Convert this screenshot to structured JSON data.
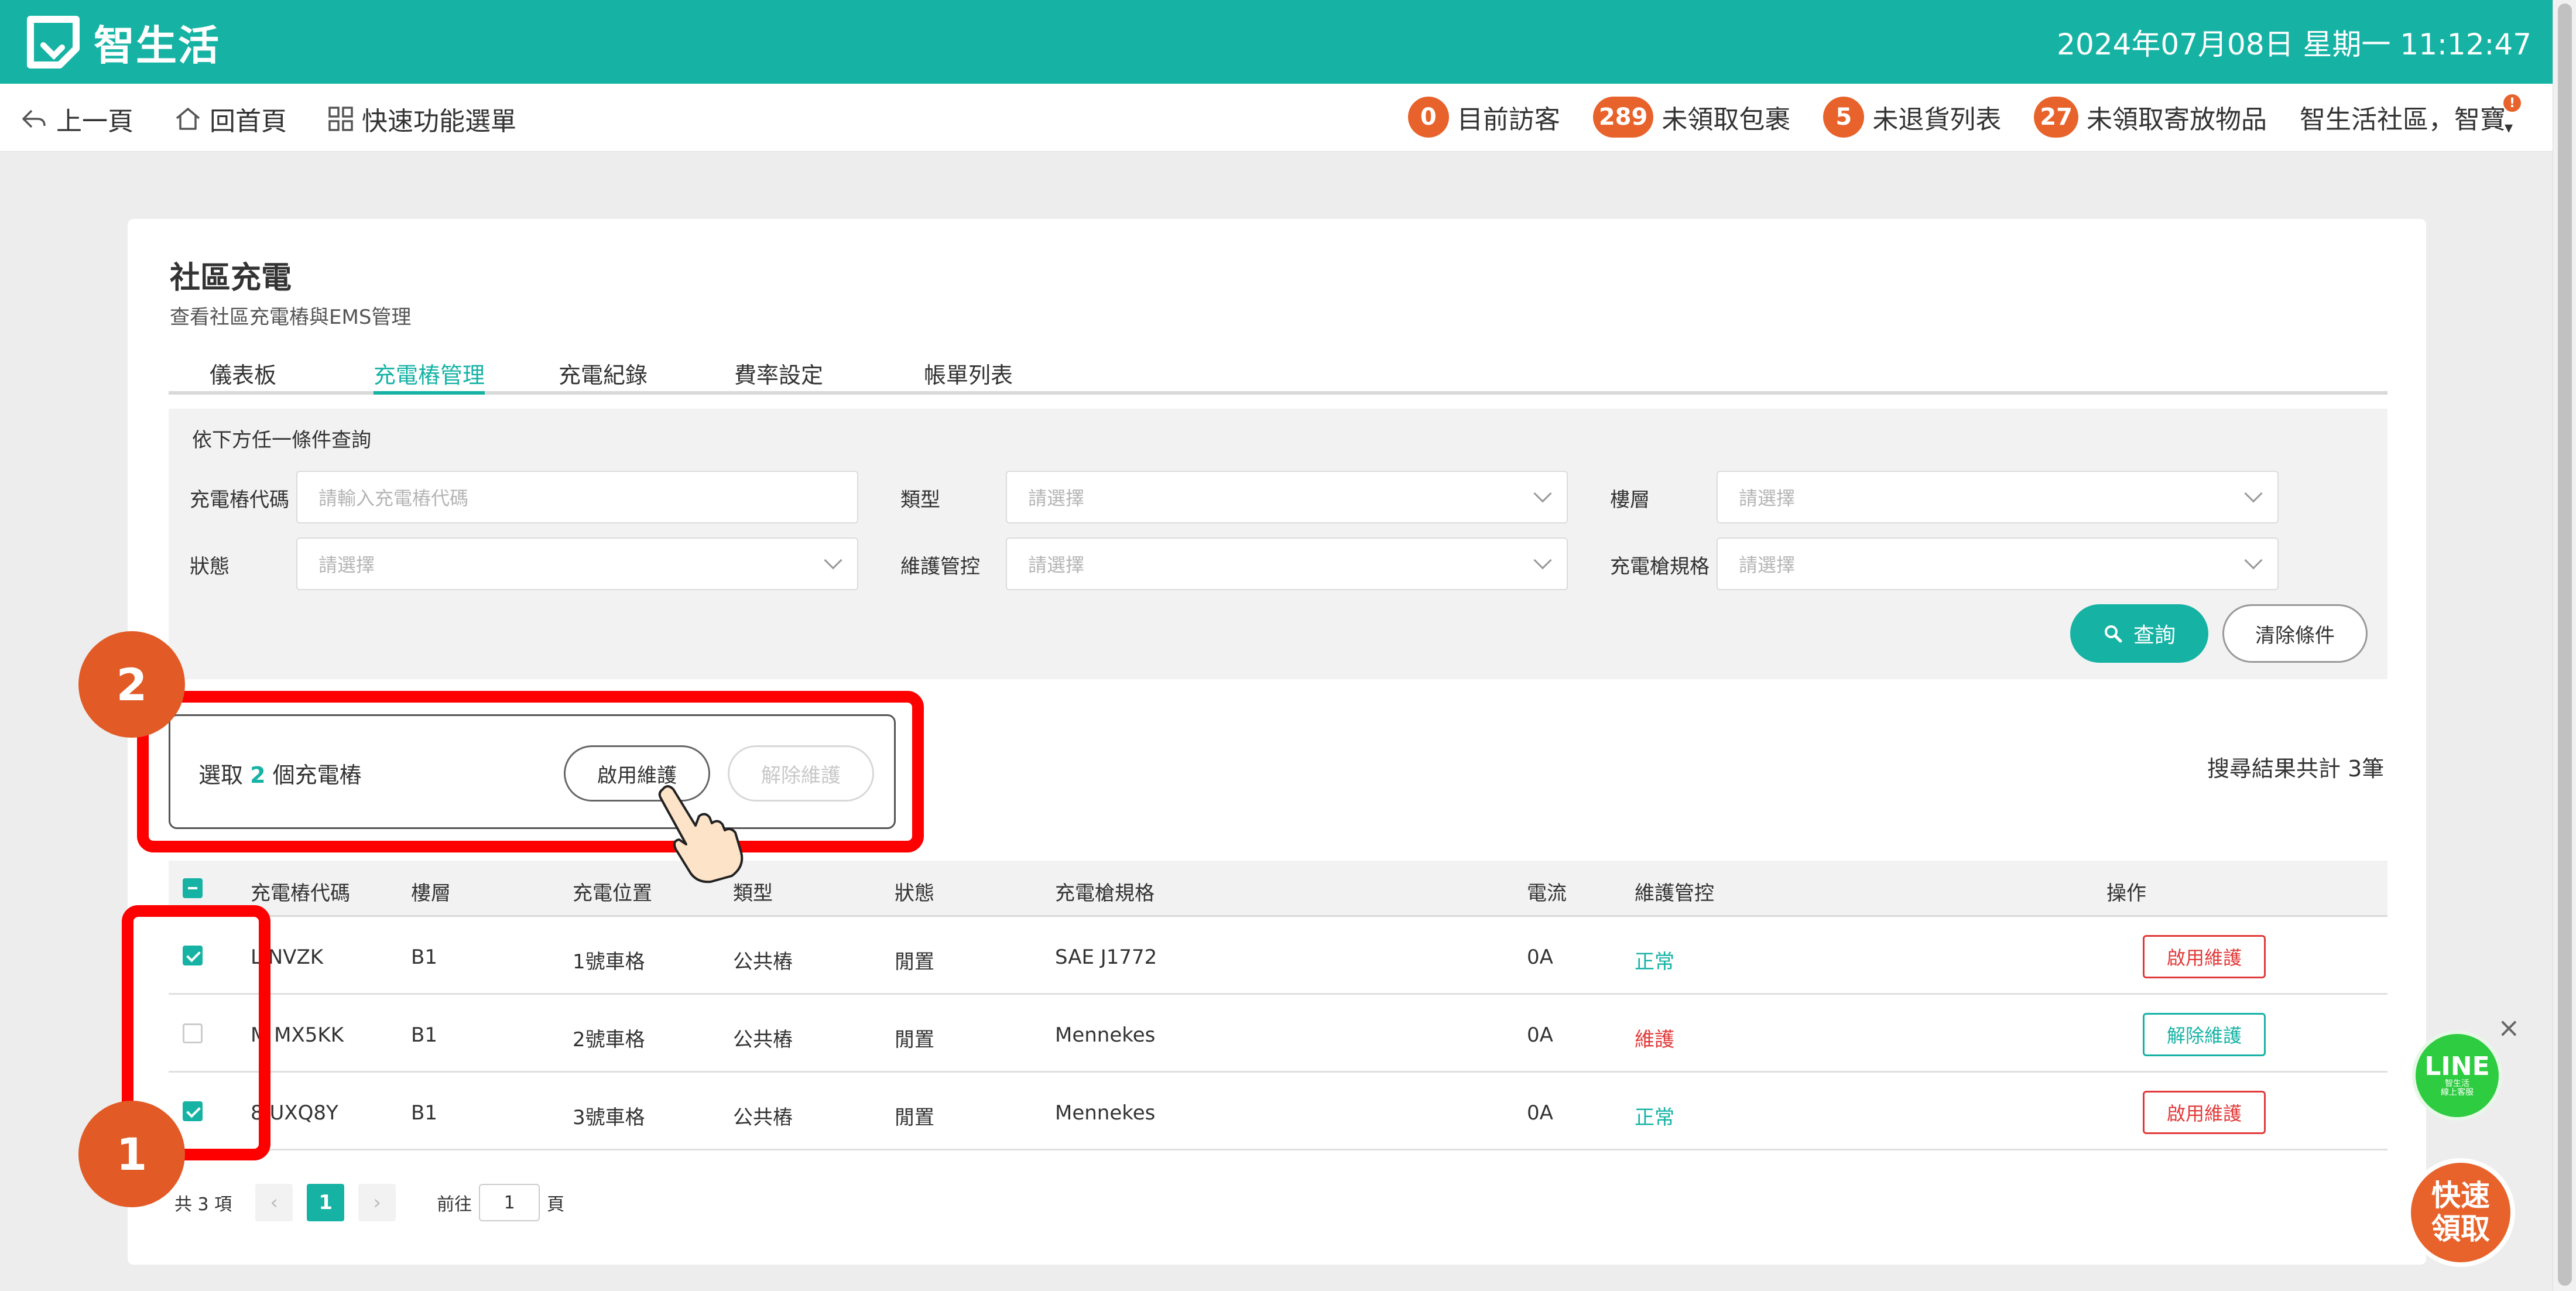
{
  "header": {
    "brand": "智生活",
    "datetime": "2024年07月08日 星期一 11:12:47"
  },
  "nav": {
    "back": "上一頁",
    "home": "回首頁",
    "quick_menu": "快速功能選單",
    "stats": [
      {
        "count": "0",
        "label": "目前訪客"
      },
      {
        "count": "289",
        "label": "未領取包裹"
      },
      {
        "count": "5",
        "label": "未退貨列表"
      },
      {
        "count": "27",
        "label": "未領取寄放物品"
      }
    ],
    "community": "智生活社區，智寶",
    "alert": "!"
  },
  "page": {
    "title": "社區充電",
    "subtitle": "查看社區充電樁與EMS管理"
  },
  "tabs": [
    "儀表板",
    "充電樁管理",
    "充電紀錄",
    "費率設定",
    "帳單列表"
  ],
  "filter": {
    "title": "依下方任一條件查詢",
    "fields": {
      "code_label": "充電樁代碼",
      "code_placeholder": "請輸入充電樁代碼",
      "type_label": "類型",
      "type_placeholder": "請選擇",
      "floor_label": "樓層",
      "floor_placeholder": "請選擇",
      "status_label": "狀態",
      "status_placeholder": "請選擇",
      "maint_label": "維護管控",
      "maint_placeholder": "請選擇",
      "spec_label": "充電槍規格",
      "spec_placeholder": "請選擇"
    },
    "query": "查詢",
    "clear": "清除條件"
  },
  "selection": {
    "prefix": "選取",
    "count": "2",
    "suffix": "個充電樁",
    "enable": "啟用維護",
    "disable": "解除維護"
  },
  "result_total": "搜尋結果共計 3筆",
  "table": {
    "headers": [
      "充電樁代碼",
      "樓層",
      "充電位置",
      "類型",
      "狀態",
      "充電槍規格",
      "電流",
      "維護管控",
      "操作"
    ],
    "rows": [
      {
        "code": "L  NVZK",
        "floor": "B1",
        "position": "1號車格",
        "type": "公共樁",
        "status": "閒置",
        "spec": "SAE J1772",
        "current": "0A",
        "maint": "正常",
        "action": "啟用維護"
      },
      {
        "code": "M  MX5KK",
        "floor": "B1",
        "position": "2號車格",
        "type": "公共樁",
        "status": "閒置",
        "spec": "Mennekes",
        "current": "0A",
        "maint": "維護",
        "action": "解除維護"
      },
      {
        "code": "8  UXQ8Y",
        "floor": "B1",
        "position": "3號車格",
        "type": "公共樁",
        "status": "閒置",
        "spec": "Mennekes",
        "current": "0A",
        "maint": "正常",
        "action": "啟用維護"
      }
    ]
  },
  "pager": {
    "total": "共 3 項",
    "prev": "‹",
    "current": "1",
    "next": "›",
    "goto_prefix": "前往",
    "goto_value": "1",
    "goto_suffix": "頁"
  },
  "steps": [
    "1",
    "2"
  ],
  "line": {
    "big": "LINE",
    "small1": "智生活",
    "small2": "線上客服",
    "close": "×"
  },
  "quick_pickup": {
    "line1": "快速",
    "line2": "領取"
  },
  "colors": {
    "primary": "#16b3a5",
    "accent": "#e8632b",
    "danger": "#e23a3a",
    "highlight": "#ff0000"
  }
}
